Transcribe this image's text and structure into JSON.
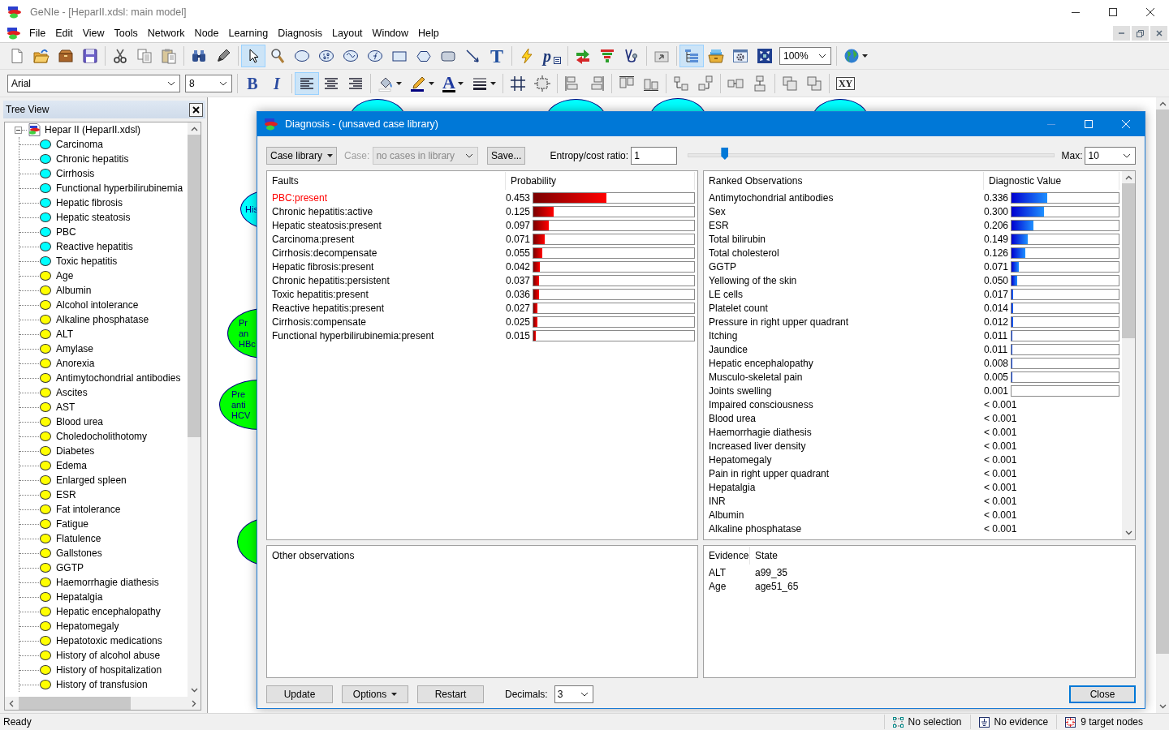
{
  "window": {
    "title": "GeNIe - [HeparII.xdsl: main model]"
  },
  "menu": [
    "File",
    "Edit",
    "View",
    "Tools",
    "Network",
    "Node",
    "Learning",
    "Diagnosis",
    "Layout",
    "Window",
    "Help"
  ],
  "toolbar_main": [
    {
      "kind": "new",
      "selected": false
    },
    {
      "kind": "open",
      "selected": false
    },
    {
      "kind": "archive",
      "selected": false
    },
    {
      "kind": "save",
      "selected": false
    },
    {
      "kind": "separator"
    },
    {
      "kind": "cut",
      "selected": false
    },
    {
      "kind": "copy",
      "selected": false
    },
    {
      "kind": "paste",
      "selected": false
    },
    {
      "kind": "separator"
    },
    {
      "kind": "find",
      "selected": false
    },
    {
      "kind": "marker",
      "selected": false
    },
    {
      "kind": "separator"
    },
    {
      "kind": "pointer",
      "selected": true
    },
    {
      "kind": "zoomtool",
      "selected": false
    },
    {
      "kind": "chance",
      "selected": false
    },
    {
      "kind": "deterministic",
      "selected": false
    },
    {
      "kind": "noisy",
      "selected": false
    },
    {
      "kind": "equation",
      "selected": false
    },
    {
      "kind": "decision",
      "selected": false
    },
    {
      "kind": "utility",
      "selected": false
    },
    {
      "kind": "submodel",
      "selected": false
    },
    {
      "kind": "arc",
      "selected": false
    },
    {
      "kind": "text",
      "label": "T",
      "selected": false
    },
    {
      "kind": "separator"
    },
    {
      "kind": "update",
      "selected": false
    },
    {
      "kind": "pequal",
      "label": "p",
      "selected": false
    },
    {
      "kind": "separator"
    },
    {
      "kind": "arrows",
      "selected": false
    },
    {
      "kind": "funnel",
      "selected": false
    },
    {
      "kind": "stethoscope",
      "selected": false
    },
    {
      "kind": "separator"
    },
    {
      "kind": "folderup",
      "selected": false
    },
    {
      "kind": "separator"
    },
    {
      "kind": "tree",
      "selected": true
    },
    {
      "kind": "cards",
      "selected": false
    },
    {
      "kind": "gearwin",
      "selected": false
    },
    {
      "kind": "expand",
      "selected": false
    },
    {
      "kind": "zoom-combo",
      "value": "100%"
    },
    {
      "kind": "separator"
    },
    {
      "kind": "globe",
      "selected": false
    }
  ],
  "toolbar_format": [
    {
      "kind": "font-combo",
      "value": "Arial"
    },
    {
      "kind": "size-combo",
      "value": "8"
    },
    {
      "kind": "separator"
    },
    {
      "kind": "bold",
      "label": "B",
      "selected": false
    },
    {
      "kind": "italic",
      "label": "I",
      "selected": false
    },
    {
      "kind": "separator"
    },
    {
      "kind": "align-left",
      "selected": true
    },
    {
      "kind": "align-center",
      "selected": false
    },
    {
      "kind": "align-right",
      "selected": false
    },
    {
      "kind": "separator"
    },
    {
      "kind": "fill",
      "selected": false
    },
    {
      "kind": "pen",
      "selected": false
    },
    {
      "kind": "fontcolor",
      "label": "A",
      "selected": false
    },
    {
      "kind": "linewidth",
      "selected": false
    },
    {
      "kind": "separator"
    },
    {
      "kind": "grid",
      "selected": false
    },
    {
      "kind": "fit",
      "selected": false
    },
    {
      "kind": "separator"
    },
    {
      "kind": "lay-left",
      "selected": false
    },
    {
      "kind": "lay-right",
      "selected": false
    },
    {
      "kind": "separator"
    },
    {
      "kind": "lay-top",
      "selected": false
    },
    {
      "kind": "lay-bottom",
      "selected": false
    },
    {
      "kind": "separator"
    },
    {
      "kind": "lay-vleft",
      "selected": false
    },
    {
      "kind": "lay-vdown",
      "selected": false
    },
    {
      "kind": "separator"
    },
    {
      "kind": "lay-hcenter",
      "selected": false
    },
    {
      "kind": "lay-vcenter",
      "selected": false
    },
    {
      "kind": "separator"
    },
    {
      "kind": "lay-back",
      "selected": false
    },
    {
      "kind": "lay-front",
      "selected": false
    },
    {
      "kind": "separator"
    },
    {
      "kind": "xy",
      "label": "XY",
      "selected": false
    }
  ],
  "tree_view": {
    "title": "Tree View",
    "root": {
      "label": "Hepar II (HeparII.xdsl)",
      "expanded": true,
      "children": [
        {
          "label": "Carcinoma",
          "color": "#00ffff"
        },
        {
          "label": "Chronic hepatitis",
          "color": "#00ffff"
        },
        {
          "label": "Cirrhosis",
          "color": "#00ffff"
        },
        {
          "label": "Functional hyperbilirubinemia",
          "color": "#00ffff"
        },
        {
          "label": "Hepatic fibrosis",
          "color": "#00ffff"
        },
        {
          "label": "Hepatic steatosis",
          "color": "#00ffff"
        },
        {
          "label": "PBC",
          "color": "#00ffff"
        },
        {
          "label": "Reactive hepatitis",
          "color": "#00ffff"
        },
        {
          "label": "Toxic hepatitis",
          "color": "#00ffff"
        },
        {
          "label": "Age",
          "color": "#ffff00"
        },
        {
          "label": "Albumin",
          "color": "#ffff00"
        },
        {
          "label": "Alcohol intolerance",
          "color": "#ffff00"
        },
        {
          "label": "Alkaline phosphatase",
          "color": "#ffff00"
        },
        {
          "label": "ALT",
          "color": "#ffff00"
        },
        {
          "label": "Amylase",
          "color": "#ffff00"
        },
        {
          "label": "Anorexia",
          "color": "#ffff00"
        },
        {
          "label": "Antimytochondrial antibodies",
          "color": "#ffff00"
        },
        {
          "label": "Ascites",
          "color": "#ffff00"
        },
        {
          "label": "AST",
          "color": "#ffff00"
        },
        {
          "label": "Blood urea",
          "color": "#ffff00"
        },
        {
          "label": "Choledocholithotomy",
          "color": "#ffff00"
        },
        {
          "label": "Diabetes",
          "color": "#ffff00"
        },
        {
          "label": "Edema",
          "color": "#ffff00"
        },
        {
          "label": "Enlarged spleen",
          "color": "#ffff00"
        },
        {
          "label": "ESR",
          "color": "#ffff00"
        },
        {
          "label": "Fat intolerance",
          "color": "#ffff00"
        },
        {
          "label": "Fatigue",
          "color": "#ffff00"
        },
        {
          "label": "Flatulence",
          "color": "#ffff00"
        },
        {
          "label": "Gallstones",
          "color": "#ffff00"
        },
        {
          "label": "GGTP",
          "color": "#ffff00"
        },
        {
          "label": "Haemorrhagie diathesis",
          "color": "#ffff00"
        },
        {
          "label": "Hepatalgia",
          "color": "#ffff00"
        },
        {
          "label": "Hepatic encephalopathy",
          "color": "#ffff00"
        },
        {
          "label": "Hepatomegaly",
          "color": "#ffff00"
        },
        {
          "label": "Hepatotoxic medications",
          "color": "#ffff00"
        },
        {
          "label": "History of alcohol abuse",
          "color": "#ffff00"
        },
        {
          "label": "History of hospitalization",
          "color": "#ffff00"
        },
        {
          "label": "History of transfusion",
          "color": "#ffff00"
        }
      ]
    }
  },
  "canvas": {
    "nodes": [
      {
        "color": "#00ffff",
        "lines": [
          "His"
        ]
      },
      {
        "color": "#00ff00",
        "lines": [
          "Pr",
          "an",
          "HBc"
        ]
      },
      {
        "color": "#00ff00",
        "lines": [
          "Pre",
          "anti",
          "HCV"
        ]
      },
      {
        "color": "#00ff00"
      },
      {
        "color": "#00ffff"
      },
      {
        "color": "#00ffff"
      },
      {
        "color": "#00ffff"
      },
      {
        "color": "#00ffff"
      }
    ]
  },
  "diagnosis": {
    "title": "Diagnosis - (unsaved case library)",
    "case_library_button": "Case library",
    "case_label": "Case:",
    "case_combo": {
      "value": "no cases in library",
      "disabled": true
    },
    "save_button": "Save...",
    "entropy_label": "Entropy/cost ratio:",
    "entropy_value": "1",
    "entropy_slider": {
      "level": 0.1
    },
    "max_label": "Max:",
    "max_value": "10",
    "faults": {
      "columns": [
        "Faults",
        "Probability"
      ],
      "rows": [
        {
          "name": "PBC:present",
          "value": "0.453",
          "level": 0.453,
          "highlighted": true
        },
        {
          "name": "Chronic hepatitis:active",
          "value": "0.125",
          "level": 0.125,
          "highlighted": false
        },
        {
          "name": "Hepatic steatosis:present",
          "value": "0.097",
          "level": 0.097,
          "highlighted": false
        },
        {
          "name": "Carcinoma:present",
          "value": "0.071",
          "level": 0.071,
          "highlighted": false
        },
        {
          "name": "Cirrhosis:decompensate",
          "value": "0.055",
          "level": 0.055,
          "highlighted": false
        },
        {
          "name": "Hepatic fibrosis:present",
          "value": "0.042",
          "level": 0.042,
          "highlighted": false
        },
        {
          "name": "Chronic hepatitis:persistent",
          "value": "0.037",
          "level": 0.037,
          "highlighted": false
        },
        {
          "name": "Toxic hepatitis:present",
          "value": "0.036",
          "level": 0.036,
          "highlighted": false
        },
        {
          "name": "Reactive hepatitis:present",
          "value": "0.027",
          "level": 0.027,
          "highlighted": false
        },
        {
          "name": "Cirrhosis:compensate",
          "value": "0.025",
          "level": 0.025,
          "highlighted": false
        },
        {
          "name": "Functional hyperbilirubinemia:present",
          "value": "0.015",
          "level": 0.015,
          "highlighted": false
        }
      ]
    },
    "observations": {
      "columns": [
        "Ranked Observations",
        "Diagnostic Value"
      ],
      "rows": [
        {
          "name": "Antimytochondrial antibodies",
          "value": "0.336",
          "level": 0.336
        },
        {
          "name": "Sex",
          "value": "0.300",
          "level": 0.3
        },
        {
          "name": "ESR",
          "value": "0.206",
          "level": 0.206
        },
        {
          "name": "Total bilirubin",
          "value": "0.149",
          "level": 0.149
        },
        {
          "name": "Total cholesterol",
          "value": "0.126",
          "level": 0.126
        },
        {
          "name": "GGTP",
          "value": "0.071",
          "level": 0.071
        },
        {
          "name": "Yellowing of the skin",
          "value": "0.050",
          "level": 0.05
        },
        {
          "name": "LE cells",
          "value": "0.017",
          "level": 0.017
        },
        {
          "name": "Platelet count",
          "value": "0.014",
          "level": 0.014
        },
        {
          "name": "Pressure in right upper quadrant",
          "value": "0.012",
          "level": 0.012
        },
        {
          "name": "Itching",
          "value": "0.011",
          "level": 0.011
        },
        {
          "name": "Jaundice",
          "value": "0.011",
          "level": 0.011
        },
        {
          "name": "Hepatic encephalopathy",
          "value": "0.008",
          "level": 0.008
        },
        {
          "name": "Musculo-skeletal pain",
          "value": "0.005",
          "level": 0.005
        },
        {
          "name": "Joints swelling",
          "value": "0.001",
          "level": 0.001
        },
        {
          "name": "Impaired consciousness",
          "value": "< 0.001"
        },
        {
          "name": "Blood urea",
          "value": "< 0.001"
        },
        {
          "name": "Haemorrhagie diathesis",
          "value": "< 0.001"
        },
        {
          "name": "Increased liver density",
          "value": "< 0.001"
        },
        {
          "name": "Hepatomegaly",
          "value": "< 0.001"
        },
        {
          "name": "Pain in right upper quadrant",
          "value": "< 0.001"
        },
        {
          "name": "Hepatalgia",
          "value": "< 0.001"
        },
        {
          "name": "INR",
          "value": "< 0.001"
        },
        {
          "name": "Albumin",
          "value": "< 0.001"
        },
        {
          "name": "Alkaline phosphatase",
          "value": "< 0.001"
        }
      ]
    },
    "other_observations": {
      "title": "Other observations"
    },
    "evidence": {
      "columns": [
        "Evidence",
        "State"
      ],
      "rows": [
        {
          "node": "ALT",
          "state": "a99_35"
        },
        {
          "node": "Age",
          "state": "age51_65"
        }
      ]
    },
    "buttons": {
      "update": "Update",
      "options": "Options",
      "restart": "Restart",
      "decimals_label": "Decimals:",
      "decimals_value": "3",
      "close": "Close"
    }
  },
  "status_bar": {
    "message": "Ready",
    "panes": [
      {
        "kind": "selection",
        "text": "No selection"
      },
      {
        "kind": "evidence",
        "text": "No evidence"
      },
      {
        "kind": "targets",
        "text": "9 target nodes"
      }
    ]
  }
}
